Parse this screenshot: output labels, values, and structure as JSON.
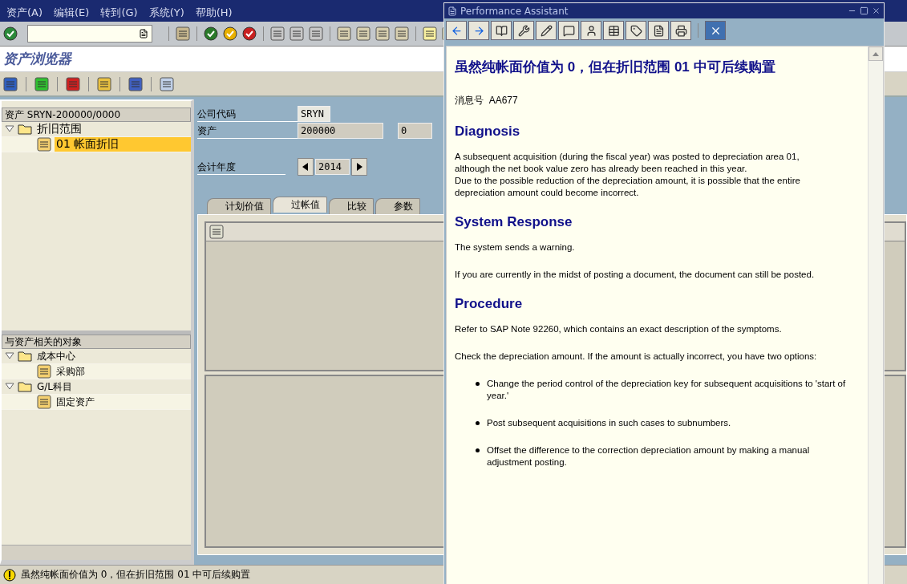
{
  "menu": [
    {
      "label": "资产(A)"
    },
    {
      "label": "编辑(E)"
    },
    {
      "label": "转到(G)"
    },
    {
      "label": "系统(Y)"
    },
    {
      "label": "帮助(H)"
    }
  ],
  "title": "资产浏览器",
  "asset_tree": {
    "header": "资产 SRYN-200000/0000",
    "items": [
      {
        "label": "折旧范围",
        "expanded": true,
        "children": [
          {
            "label": "01  帐面折旧",
            "selected": true
          }
        ]
      }
    ]
  },
  "related_objects": {
    "header": "与资产相关的对象",
    "items": [
      {
        "label": "成本中心",
        "expanded": true,
        "children": [
          {
            "label": "采购部",
            "selected": false
          }
        ]
      },
      {
        "label": "G/L科目",
        "expanded": true,
        "children": [
          {
            "label": "固定资产",
            "selected": false
          }
        ]
      }
    ]
  },
  "form": {
    "company_code": {
      "label": "公司代码",
      "value": "SRYN"
    },
    "asset": {
      "label": "资产",
      "value": "200000",
      "subnumber": "0"
    },
    "fiscal_year": {
      "label": "会计年度",
      "value": "2014"
    }
  },
  "tabs": [
    {
      "label": "计划价值",
      "selected": false
    },
    {
      "label": "过帐值",
      "selected": true
    },
    {
      "label": "比较",
      "selected": false
    },
    {
      "label": "参数",
      "selected": false
    }
  ],
  "status_bar": {
    "message": "虽然纯帐面价值为 0，但在折旧范围 01 中可后续购置"
  },
  "assistant": {
    "title": "Performance Assistant",
    "heading": "虽然纯帐面价值为  0，但在折旧范围  01 中可后续购置",
    "message_label": "消息号",
    "message_number": "AA677",
    "sections": [
      {
        "title": "Diagnosis",
        "blocks": [
          {
            "kind": "para",
            "lines": [
              "A subsequent acquisition (during the fiscal year) was posted to depreciation area 01, although the net book value zero has already been reached in this year.",
              "Due to the possible reduction of the depreciation amount, it is possible that the entire depreciation amount could become incorrect."
            ]
          }
        ]
      },
      {
        "title": "System Response",
        "blocks": [
          {
            "kind": "para",
            "lines": [
              "The system sends a warning."
            ]
          },
          {
            "kind": "para",
            "lines": [
              "If you are currently in the midst of posting a document, the document can still be posted."
            ]
          }
        ]
      },
      {
        "title": "Procedure",
        "blocks": [
          {
            "kind": "para",
            "lines": [
              "Refer to SAP Note 92260, which contains an exact description of the symptoms."
            ]
          },
          {
            "kind": "para",
            "lines": [
              "Check the depreciation amount. If the amount is actually incorrect, you have two options:"
            ]
          },
          {
            "kind": "bullets",
            "items": [
              "Change the period control of the depreciation key for subsequent acquisitions to 'start of year.'",
              "Post subsequent acquisitions in such cases to subnumbers.",
              "Offset the difference to the correction depreciation amount by making a manual adjustment posting."
            ]
          }
        ]
      }
    ]
  }
}
